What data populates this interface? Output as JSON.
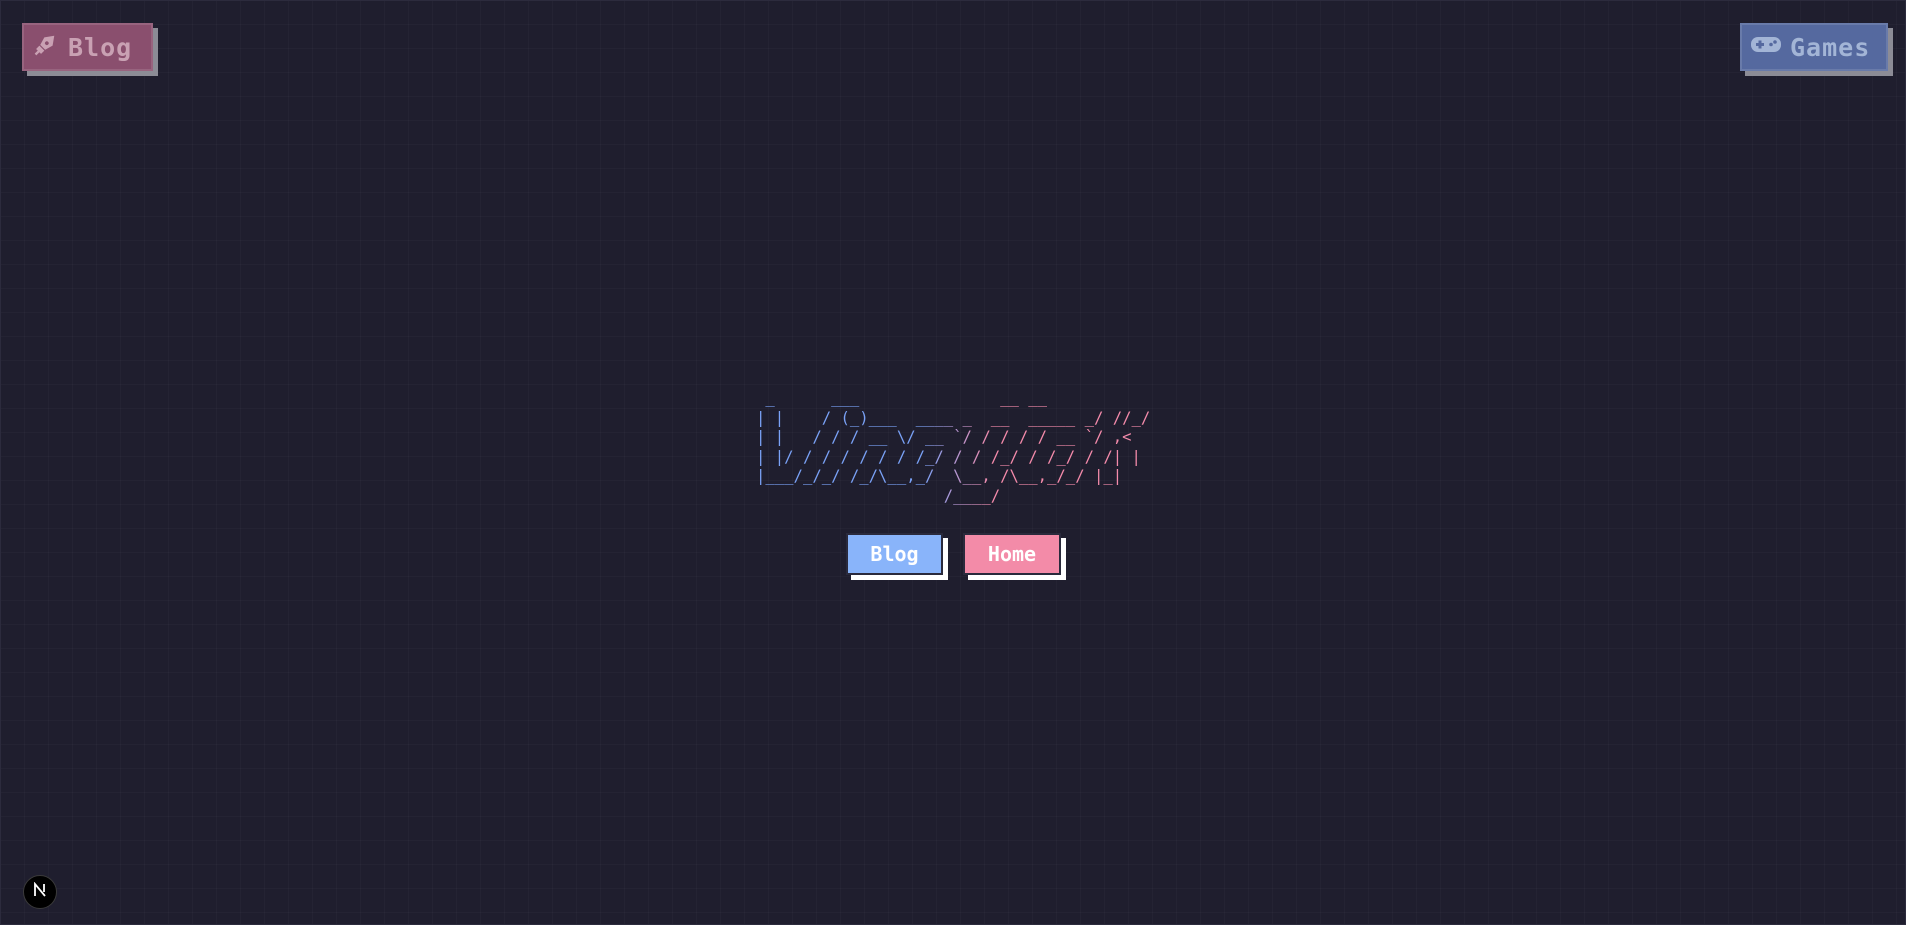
{
  "corner_nav": {
    "blog": {
      "label": "Blog",
      "icon": "pen-nib-icon"
    },
    "games": {
      "label": "Games",
      "icon": "gamepad-icon"
    }
  },
  "logo": {
    "ascii_lines": [
      " _      ___               __ __",
      "| |    / (_)___  ____ _  __  _____ _/ //_/",
      "| |   / / / __ \\/ __ `/ / / / / __ `/ ,<",
      "| |/ / / / / / / /_/ / / /_/ / /_/ / /| |",
      "|___/_/_/ /_/\\__,_/  \\__, /\\__,_/_/ |_|",
      "                    /____/"
    ]
  },
  "nav_buttons": {
    "blog_label": "Blog",
    "home_label": "Home"
  },
  "badge": {
    "icon": "nextjs-logo-icon",
    "letter": "N"
  },
  "colors": {
    "background": "#1f1e2e",
    "blue": "#89b4fa",
    "pink": "#f38ba8",
    "corner_blog_bg": "#8a4f6e",
    "corner_games_bg": "#55699f"
  }
}
